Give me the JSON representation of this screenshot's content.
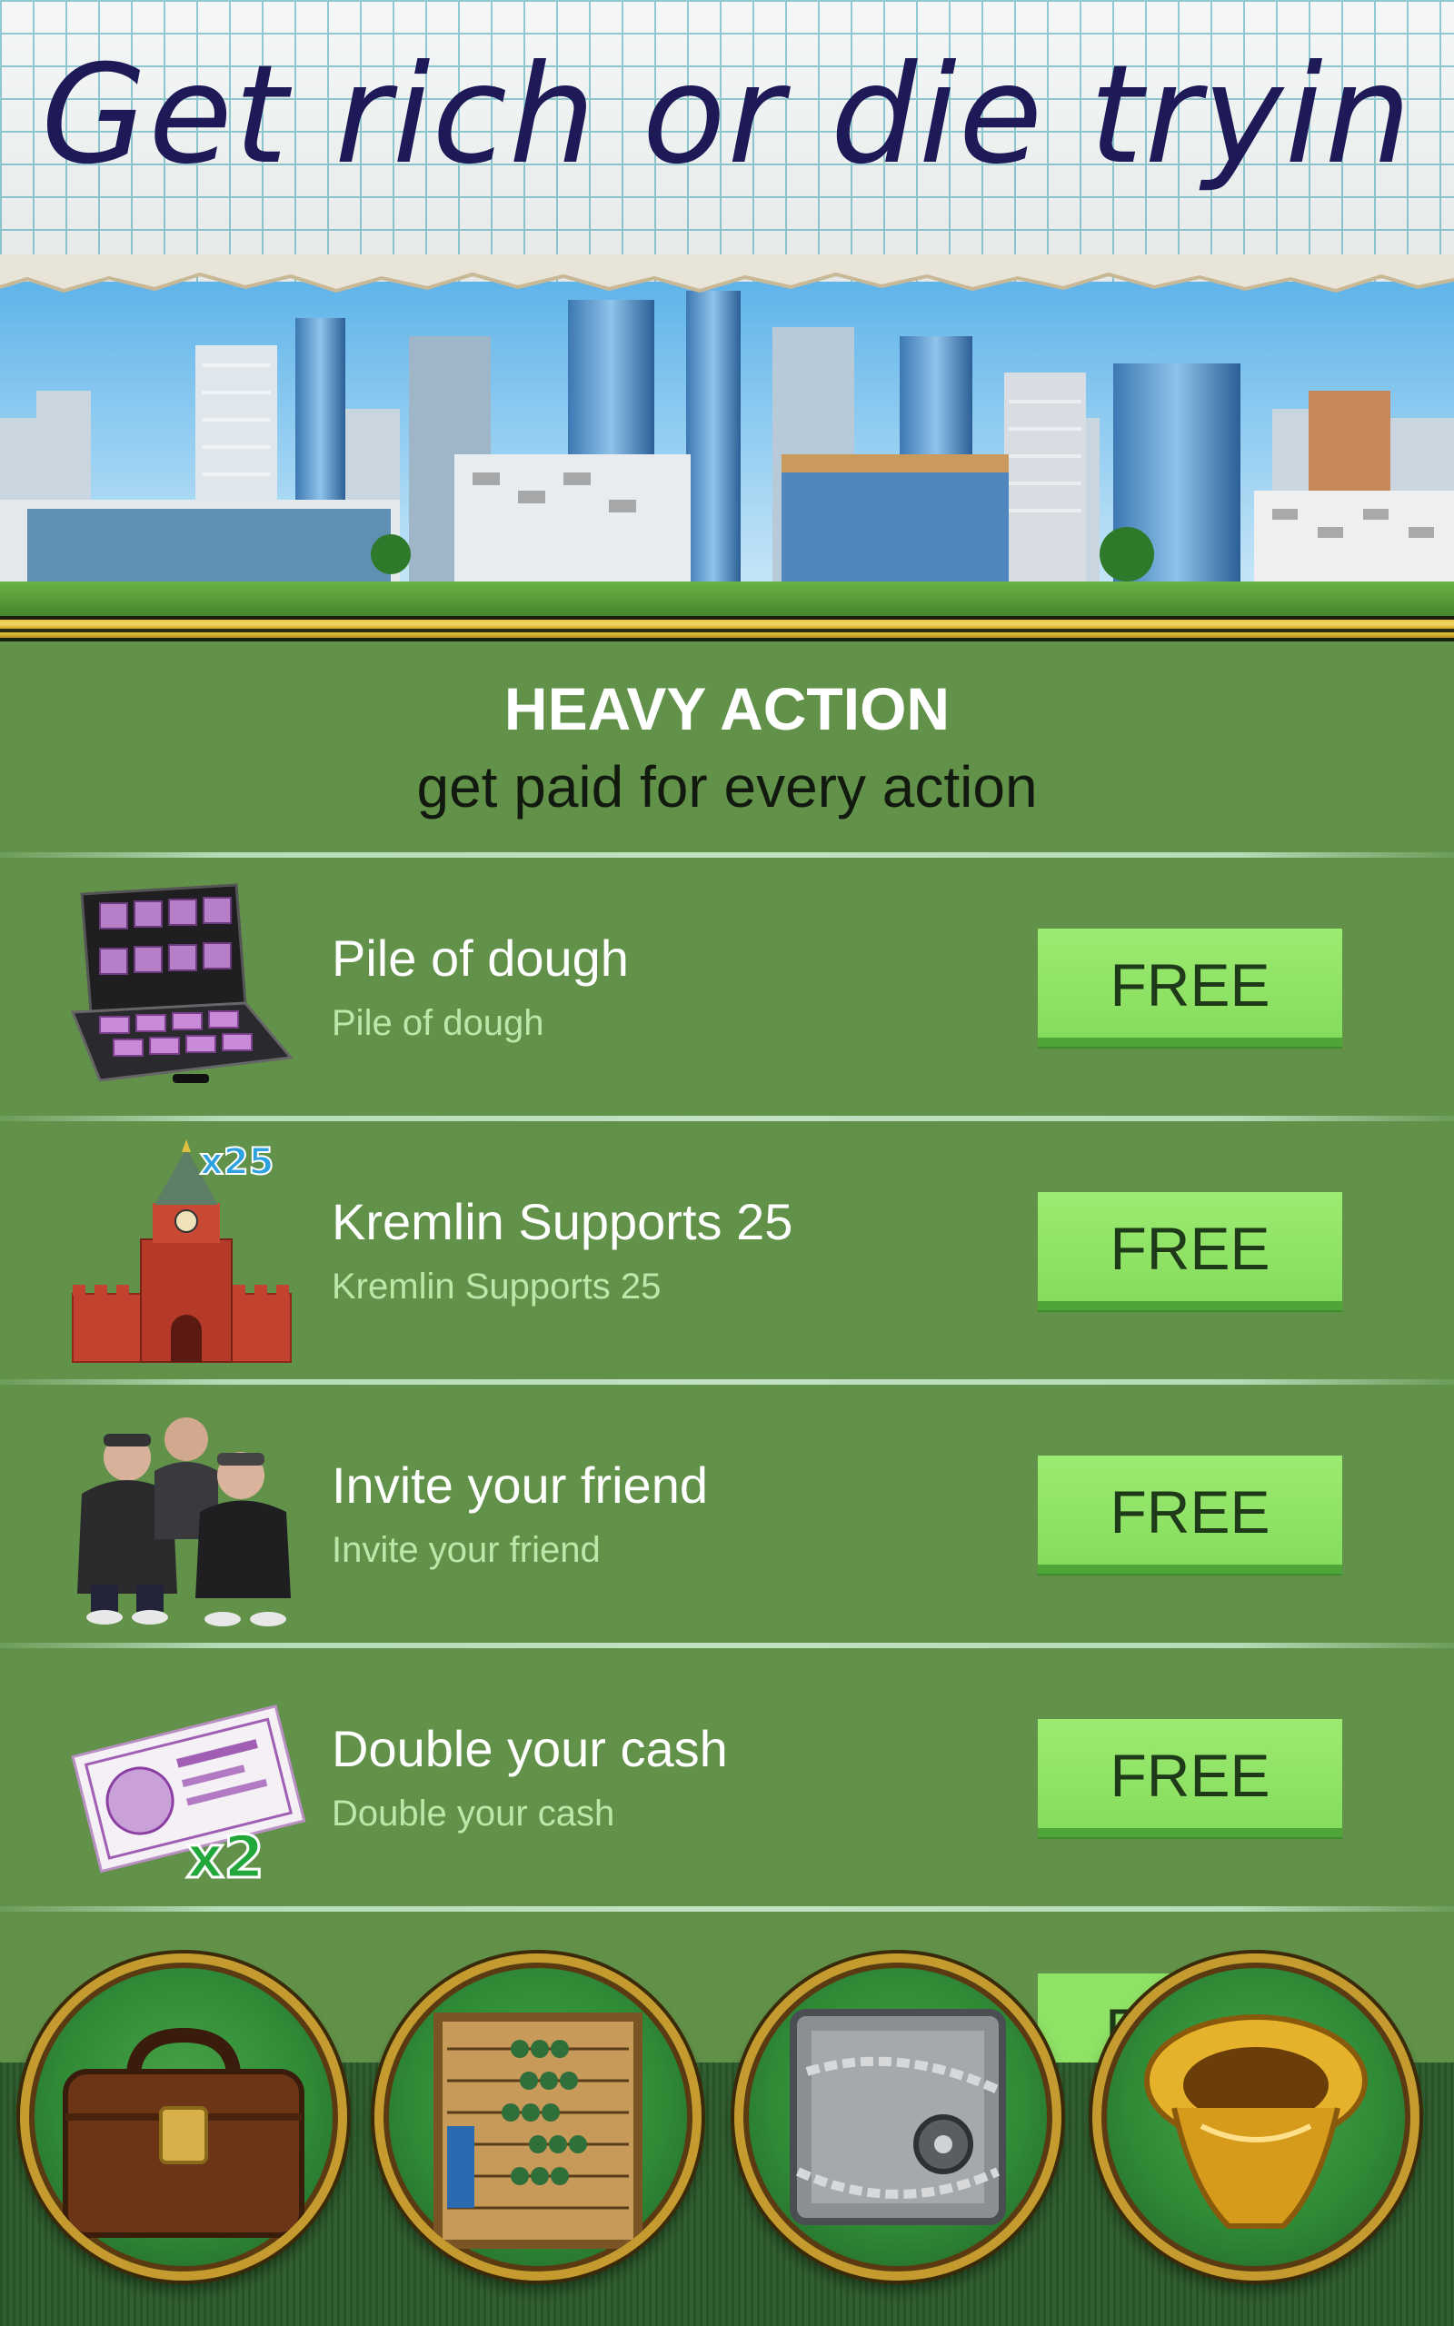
{
  "header": {
    "title": "Get rich or die tryin"
  },
  "section": {
    "title": "HEAVY ACTION",
    "subtitle": "get paid for every action"
  },
  "offers": [
    {
      "title": "Pile of dough",
      "subtitle": "Pile of dough",
      "button": "FREE",
      "icon": "briefcase-of-money-icon"
    },
    {
      "title": "Kremlin Supports 25",
      "subtitle": "Kremlin Supports 25",
      "button": "FREE",
      "icon": "kremlin-tower-icon",
      "badge": "x25"
    },
    {
      "title": "Invite your friend",
      "subtitle": "Invite your friend",
      "button": "FREE",
      "icon": "three-men-icon"
    },
    {
      "title": "Double your cash",
      "subtitle": "Double your cash",
      "button": "FREE",
      "icon": "banknote-icon",
      "badge": "x2"
    }
  ],
  "peek_button": "F",
  "nav": [
    {
      "icon": "briefcase-icon"
    },
    {
      "icon": "abacus-icon"
    },
    {
      "icon": "safe-icon"
    },
    {
      "icon": "golden-toilet-icon"
    }
  ],
  "colors": {
    "background": "#62924a",
    "button": "#8fe266",
    "title_ink": "#1e1a57"
  }
}
